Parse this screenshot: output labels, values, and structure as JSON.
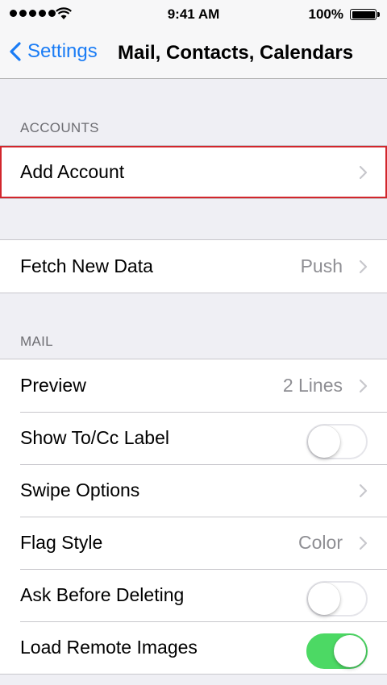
{
  "status_bar": {
    "time": "9:41 AM",
    "battery_percent": "100%"
  },
  "nav": {
    "back_label": "Settings",
    "title": "Mail, Contacts, Calendars"
  },
  "accounts": {
    "header": "ACCOUNTS",
    "add_account": "Add Account"
  },
  "fetch": {
    "label": "Fetch New Data",
    "value": "Push"
  },
  "mail": {
    "header": "MAIL",
    "preview": {
      "label": "Preview",
      "value": "2 Lines"
    },
    "show_to_cc": {
      "label": "Show To/Cc Label",
      "on": false
    },
    "swipe_options": {
      "label": "Swipe Options"
    },
    "flag_style": {
      "label": "Flag Style",
      "value": "Color"
    },
    "ask_before_deleting": {
      "label": "Ask Before Deleting",
      "on": false
    },
    "load_remote_images": {
      "label": "Load Remote Images",
      "on": true
    }
  },
  "colors": {
    "accent": "#1a7cf5",
    "toggle_on": "#4cd964",
    "highlight": "#d2262c"
  }
}
